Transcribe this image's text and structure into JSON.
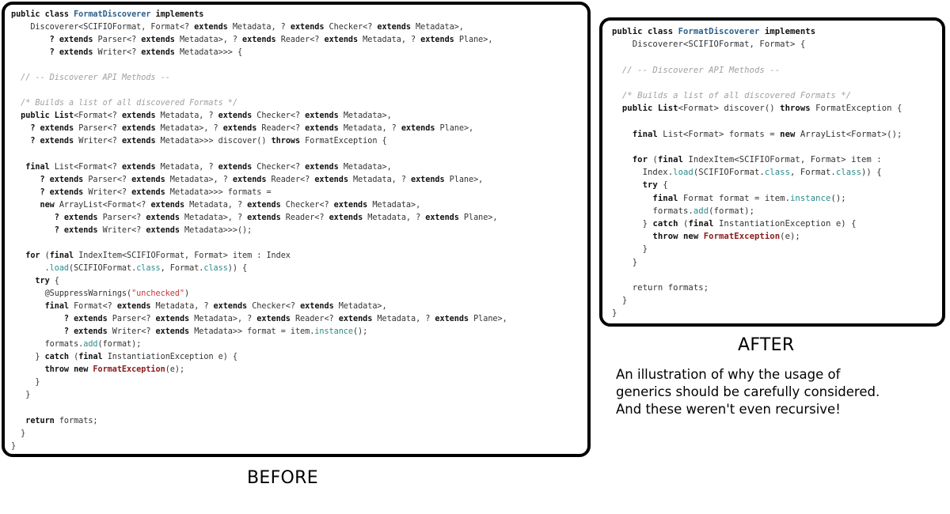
{
  "before": {
    "label": "BEFORE",
    "code_lines": [
      [
        {
          "t": "public class ",
          "c": "kw"
        },
        {
          "t": "FormatDiscoverer",
          "c": "cls"
        },
        {
          "t": " implements",
          "c": "kw"
        }
      ],
      [
        {
          "t": "    Discoverer<SCIFIOFormat, Format<? ",
          "c": "type"
        },
        {
          "t": "extends",
          "c": "kw"
        },
        {
          "t": " Metadata, ? ",
          "c": "type"
        },
        {
          "t": "extends",
          "c": "kw"
        },
        {
          "t": " Checker<? ",
          "c": "type"
        },
        {
          "t": "extends",
          "c": "kw"
        },
        {
          "t": " Metadata>,",
          "c": "type"
        }
      ],
      [
        {
          "t": "        ? ",
          "c": "kw"
        },
        {
          "t": "extends",
          "c": "kw"
        },
        {
          "t": " Parser<? ",
          "c": "type"
        },
        {
          "t": "extends",
          "c": "kw"
        },
        {
          "t": " Metadata>, ? ",
          "c": "type"
        },
        {
          "t": "extends",
          "c": "kw"
        },
        {
          "t": " Reader<? ",
          "c": "type"
        },
        {
          "t": "extends",
          "c": "kw"
        },
        {
          "t": " Metadata, ? ",
          "c": "type"
        },
        {
          "t": "extends",
          "c": "kw"
        },
        {
          "t": " Plane>,",
          "c": "type"
        }
      ],
      [
        {
          "t": "        ? ",
          "c": "kw"
        },
        {
          "t": "extends",
          "c": "kw"
        },
        {
          "t": " Writer<? ",
          "c": "type"
        },
        {
          "t": "extends",
          "c": "kw"
        },
        {
          "t": " Metadata>>> {",
          "c": "type"
        }
      ],
      [],
      [
        {
          "t": "  // -- Discoverer API Methods --",
          "c": "cmt"
        }
      ],
      [],
      [
        {
          "t": "  /* Builds a list of all discovered Formats */",
          "c": "cmt"
        }
      ],
      [
        {
          "t": "  public List",
          "c": "kw"
        },
        {
          "t": "<Format<? ",
          "c": "type"
        },
        {
          "t": "extends",
          "c": "kw"
        },
        {
          "t": " Metadata, ? ",
          "c": "type"
        },
        {
          "t": "extends",
          "c": "kw"
        },
        {
          "t": " Checker<? ",
          "c": "type"
        },
        {
          "t": "extends",
          "c": "kw"
        },
        {
          "t": " Metadata>,",
          "c": "type"
        }
      ],
      [
        {
          "t": "    ? ",
          "c": "kw"
        },
        {
          "t": "extends",
          "c": "kw"
        },
        {
          "t": " Parser<? ",
          "c": "type"
        },
        {
          "t": "extends",
          "c": "kw"
        },
        {
          "t": " Metadata>, ? ",
          "c": "type"
        },
        {
          "t": "extends",
          "c": "kw"
        },
        {
          "t": " Reader<? ",
          "c": "type"
        },
        {
          "t": "extends",
          "c": "kw"
        },
        {
          "t": " Metadata, ? ",
          "c": "type"
        },
        {
          "t": "extends",
          "c": "kw"
        },
        {
          "t": " Plane>,",
          "c": "type"
        }
      ],
      [
        {
          "t": "    ? ",
          "c": "kw"
        },
        {
          "t": "extends",
          "c": "kw"
        },
        {
          "t": " Writer<? ",
          "c": "type"
        },
        {
          "t": "extends",
          "c": "kw"
        },
        {
          "t": " Metadata>>> discover() ",
          "c": "type"
        },
        {
          "t": "throws",
          "c": "kw"
        },
        {
          "t": " FormatException {",
          "c": "type"
        }
      ],
      [],
      [
        {
          "t": "   final",
          "c": "kw"
        },
        {
          "t": " List<Format<? ",
          "c": "type"
        },
        {
          "t": "extends",
          "c": "kw"
        },
        {
          "t": " Metadata, ? ",
          "c": "type"
        },
        {
          "t": "extends",
          "c": "kw"
        },
        {
          "t": " Checker<? ",
          "c": "type"
        },
        {
          "t": "extends",
          "c": "kw"
        },
        {
          "t": " Metadata>,",
          "c": "type"
        }
      ],
      [
        {
          "t": "      ? ",
          "c": "kw"
        },
        {
          "t": "extends",
          "c": "kw"
        },
        {
          "t": " Parser<? ",
          "c": "type"
        },
        {
          "t": "extends",
          "c": "kw"
        },
        {
          "t": " Metadata>, ? ",
          "c": "type"
        },
        {
          "t": "extends",
          "c": "kw"
        },
        {
          "t": " Reader<? ",
          "c": "type"
        },
        {
          "t": "extends",
          "c": "kw"
        },
        {
          "t": " Metadata, ? ",
          "c": "type"
        },
        {
          "t": "extends",
          "c": "kw"
        },
        {
          "t": " Plane>,",
          "c": "type"
        }
      ],
      [
        {
          "t": "      ? ",
          "c": "kw"
        },
        {
          "t": "extends",
          "c": "kw"
        },
        {
          "t": " Writer<? ",
          "c": "type"
        },
        {
          "t": "extends",
          "c": "kw"
        },
        {
          "t": " Metadata>>> formats =",
          "c": "type"
        }
      ],
      [
        {
          "t": "      new",
          "c": "kw"
        },
        {
          "t": " ArrayList<Format<? ",
          "c": "type"
        },
        {
          "t": "extends",
          "c": "kw"
        },
        {
          "t": " Metadata, ? ",
          "c": "type"
        },
        {
          "t": "extends",
          "c": "kw"
        },
        {
          "t": " Checker<? ",
          "c": "type"
        },
        {
          "t": "extends",
          "c": "kw"
        },
        {
          "t": " Metadata>,",
          "c": "type"
        }
      ],
      [
        {
          "t": "         ? ",
          "c": "kw"
        },
        {
          "t": "extends",
          "c": "kw"
        },
        {
          "t": " Parser<? ",
          "c": "type"
        },
        {
          "t": "extends",
          "c": "kw"
        },
        {
          "t": " Metadata>, ? ",
          "c": "type"
        },
        {
          "t": "extends",
          "c": "kw"
        },
        {
          "t": " Reader<? ",
          "c": "type"
        },
        {
          "t": "extends",
          "c": "kw"
        },
        {
          "t": " Metadata, ? ",
          "c": "type"
        },
        {
          "t": "extends",
          "c": "kw"
        },
        {
          "t": " Plane>,",
          "c": "type"
        }
      ],
      [
        {
          "t": "         ? ",
          "c": "kw"
        },
        {
          "t": "extends",
          "c": "kw"
        },
        {
          "t": " Writer<? ",
          "c": "type"
        },
        {
          "t": "extends",
          "c": "kw"
        },
        {
          "t": " Metadata>>>();",
          "c": "type"
        }
      ],
      [],
      [
        {
          "t": "   for",
          "c": "kw"
        },
        {
          "t": " (",
          "c": "type"
        },
        {
          "t": "final",
          "c": "kw"
        },
        {
          "t": " IndexItem<SCIFIOFormat, Format> item : Index",
          "c": "type"
        }
      ],
      [
        {
          "t": "       .",
          "c": "type"
        },
        {
          "t": "load",
          "c": "mth"
        },
        {
          "t": "(SCIFIOFormat.",
          "c": "type"
        },
        {
          "t": "class",
          "c": "mth"
        },
        {
          "t": ", Format.",
          "c": "type"
        },
        {
          "t": "class",
          "c": "mth"
        },
        {
          "t": ")) {",
          "c": "type"
        }
      ],
      [
        {
          "t": "     try",
          "c": "kw"
        },
        {
          "t": " {",
          "c": "type"
        }
      ],
      [
        {
          "t": "       @SuppressWarnings(",
          "c": "type"
        },
        {
          "t": "\"unchecked\"",
          "c": "str"
        },
        {
          "t": ")",
          "c": "type"
        }
      ],
      [
        {
          "t": "       final",
          "c": "kw"
        },
        {
          "t": " Format<? ",
          "c": "type"
        },
        {
          "t": "extends",
          "c": "kw"
        },
        {
          "t": " Metadata, ? ",
          "c": "type"
        },
        {
          "t": "extends",
          "c": "kw"
        },
        {
          "t": " Checker<? ",
          "c": "type"
        },
        {
          "t": "extends",
          "c": "kw"
        },
        {
          "t": " Metadata>,",
          "c": "type"
        }
      ],
      [
        {
          "t": "           ? ",
          "c": "kw"
        },
        {
          "t": "extends",
          "c": "kw"
        },
        {
          "t": " Parser<? ",
          "c": "type"
        },
        {
          "t": "extends",
          "c": "kw"
        },
        {
          "t": " Metadata>, ? ",
          "c": "type"
        },
        {
          "t": "extends",
          "c": "kw"
        },
        {
          "t": " Reader<? ",
          "c": "type"
        },
        {
          "t": "extends",
          "c": "kw"
        },
        {
          "t": " Metadata, ? ",
          "c": "type"
        },
        {
          "t": "extends",
          "c": "kw"
        },
        {
          "t": " Plane>,",
          "c": "type"
        }
      ],
      [
        {
          "t": "           ? ",
          "c": "kw"
        },
        {
          "t": "extends",
          "c": "kw"
        },
        {
          "t": " Writer<? ",
          "c": "type"
        },
        {
          "t": "extends",
          "c": "kw"
        },
        {
          "t": " Metadata>> format = item.",
          "c": "type"
        },
        {
          "t": "instance",
          "c": "mth"
        },
        {
          "t": "();",
          "c": "type"
        }
      ],
      [
        {
          "t": "       formats.",
          "c": "type"
        },
        {
          "t": "add",
          "c": "mth"
        },
        {
          "t": "(format);",
          "c": "type"
        }
      ],
      [
        {
          "t": "     } ",
          "c": "type"
        },
        {
          "t": "catch",
          "c": "kw"
        },
        {
          "t": " (",
          "c": "type"
        },
        {
          "t": "final",
          "c": "kw"
        },
        {
          "t": " InstantiationException e) {",
          "c": "type"
        }
      ],
      [
        {
          "t": "       throw new ",
          "c": "kw"
        },
        {
          "t": "FormatException",
          "c": "exc"
        },
        {
          "t": "(e);",
          "c": "type"
        }
      ],
      [
        {
          "t": "     }",
          "c": "type"
        }
      ],
      [
        {
          "t": "   }",
          "c": "type"
        }
      ],
      [],
      [
        {
          "t": "   return",
          "c": "kw"
        },
        {
          "t": " formats;",
          "c": "type"
        }
      ],
      [
        {
          "t": "  }",
          "c": "type"
        }
      ],
      [
        {
          "t": "}",
          "c": "type"
        }
      ]
    ]
  },
  "after": {
    "label": "AFTER",
    "code_lines": [
      [
        {
          "t": "public class ",
          "c": "kw"
        },
        {
          "t": "FormatDiscoverer",
          "c": "cls"
        },
        {
          "t": " implements",
          "c": "kw"
        }
      ],
      [
        {
          "t": "    Discoverer<SCIFIOFormat, Format> {",
          "c": "type"
        }
      ],
      [],
      [
        {
          "t": "  // -- Discoverer API Methods --",
          "c": "cmt"
        }
      ],
      [],
      [
        {
          "t": "  /* Builds a list of all discovered Formats */",
          "c": "cmt"
        }
      ],
      [
        {
          "t": "  public List",
          "c": "kw"
        },
        {
          "t": "<Format> discover() ",
          "c": "type"
        },
        {
          "t": "throws",
          "c": "kw"
        },
        {
          "t": " FormatException {",
          "c": "type"
        }
      ],
      [],
      [
        {
          "t": "    final",
          "c": "kw"
        },
        {
          "t": " List<Format> formats = ",
          "c": "type"
        },
        {
          "t": "new",
          "c": "kw"
        },
        {
          "t": " ArrayList<Format>();",
          "c": "type"
        }
      ],
      [],
      [
        {
          "t": "    for",
          "c": "kw"
        },
        {
          "t": " (",
          "c": "type"
        },
        {
          "t": "final",
          "c": "kw"
        },
        {
          "t": " IndexItem<SCIFIOFormat, Format> item :",
          "c": "type"
        }
      ],
      [
        {
          "t": "      Index.",
          "c": "type"
        },
        {
          "t": "load",
          "c": "mth"
        },
        {
          "t": "(SCIFIOFormat.",
          "c": "type"
        },
        {
          "t": "class",
          "c": "mth"
        },
        {
          "t": ", Format.",
          "c": "type"
        },
        {
          "t": "class",
          "c": "mth"
        },
        {
          "t": ")) {",
          "c": "type"
        }
      ],
      [
        {
          "t": "      try",
          "c": "kw"
        },
        {
          "t": " {",
          "c": "type"
        }
      ],
      [
        {
          "t": "        final",
          "c": "kw"
        },
        {
          "t": " Format format = item.",
          "c": "type"
        },
        {
          "t": "instance",
          "c": "mth"
        },
        {
          "t": "();",
          "c": "type"
        }
      ],
      [
        {
          "t": "        formats.",
          "c": "type"
        },
        {
          "t": "add",
          "c": "mth"
        },
        {
          "t": "(format);",
          "c": "type"
        }
      ],
      [
        {
          "t": "      } ",
          "c": "type"
        },
        {
          "t": "catch",
          "c": "kw"
        },
        {
          "t": " (",
          "c": "type"
        },
        {
          "t": "final",
          "c": "kw"
        },
        {
          "t": " InstantiationException e) {",
          "c": "type"
        }
      ],
      [
        {
          "t": "        throw new ",
          "c": "kw"
        },
        {
          "t": "FormatException",
          "c": "exc"
        },
        {
          "t": "(e);",
          "c": "type"
        }
      ],
      [
        {
          "t": "      }",
          "c": "type"
        }
      ],
      [
        {
          "t": "    }",
          "c": "type"
        }
      ],
      [],
      [
        {
          "t": "    return formats;",
          "c": "type"
        }
      ],
      [
        {
          "t": "  }",
          "c": "type"
        }
      ],
      [
        {
          "t": "}",
          "c": "type"
        }
      ]
    ]
  },
  "caption": {
    "lines": [
      "An illustration of why the usage of",
      "generics should be carefully considered.",
      "And these weren't even recursive!"
    ]
  },
  "colors": {
    "background": "#ffffff",
    "panel_border": "#000000",
    "code_text": "#1a1a1a",
    "class_name": "#2d5f8b",
    "exception_name": "#8b1a1a",
    "method_name": "#2a8a8a",
    "string_literal": "#cc3333",
    "comment": "#a0a0a0"
  }
}
